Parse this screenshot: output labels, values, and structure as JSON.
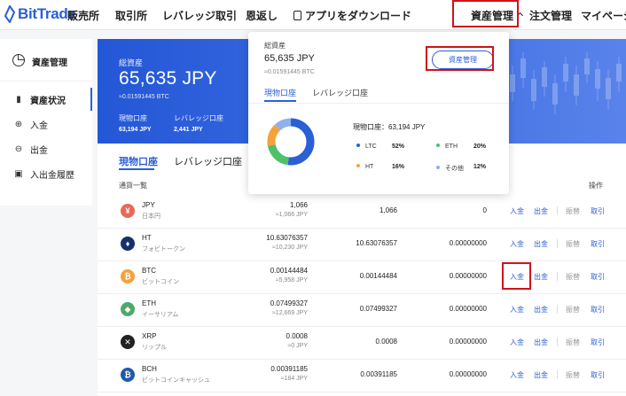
{
  "brand": {
    "name": "BitTrade",
    "color": "#2b5fd6"
  },
  "nav": {
    "exchange": "販売所",
    "trading": "取引所",
    "leverage": "レバレッジ取引",
    "rewards": "恩返し",
    "download": "アプリをダウンロード",
    "assets": "資産管理",
    "orders": "注文管理",
    "mypage": "マイページ"
  },
  "sidebar": {
    "title": "資産管理",
    "items": [
      {
        "label": "資産状況",
        "icon": "bar-chart-icon"
      },
      {
        "label": "入金",
        "icon": "deposit-icon"
      },
      {
        "label": "出金",
        "icon": "withdraw-icon"
      },
      {
        "label": "入出金履歴",
        "icon": "history-icon"
      }
    ]
  },
  "summary": {
    "label": "総資産",
    "amount": "65,635 JPY",
    "btc": "≈0.01591445 BTC",
    "spot_label": "現物口座",
    "spot_value": "63,194 JPY",
    "leverage_label": "レバレッジ口座",
    "leverage_value": "2,441 JPY"
  },
  "tabs": {
    "spot": "現物口座",
    "leverage": "レバレッジ口座"
  },
  "list": {
    "header": "通貨一覧",
    "ops_header": "操作"
  },
  "ops": {
    "deposit": "入金",
    "withdraw": "出金",
    "transfer": "振替",
    "trade": "取引"
  },
  "rows": [
    {
      "symbol": "JPY",
      "name": "日本円",
      "total": "1,066",
      "jpy": "≈1,066 JPY",
      "available": "1,066",
      "locked": "0",
      "color": "#e8685a",
      "icon": "yen-icon"
    },
    {
      "symbol": "HT",
      "name": "フォビトークン",
      "total": "10.63076357",
      "jpy": "≈10,230 JPY",
      "available": "10.63076357",
      "locked": "0.00000000",
      "color": "#17306b",
      "icon": "flame-icon"
    },
    {
      "symbol": "BTC",
      "name": "ビットコイン",
      "total": "0.00144484",
      "jpy": "≈5,958 JPY",
      "available": "0.00144484",
      "locked": "0.00000000",
      "color": "#f2a33a",
      "icon": "bitcoin-icon"
    },
    {
      "symbol": "ETH",
      "name": "イーサリアム",
      "total": "0.07499327",
      "jpy": "≈12,669 JPY",
      "available": "0.07499327",
      "locked": "0.00000000",
      "color": "#4fa86a",
      "icon": "ethereum-icon"
    },
    {
      "symbol": "XRP",
      "name": "リップル",
      "total": "0.0008",
      "jpy": "≈0 JPY",
      "available": "0.0008",
      "locked": "0.00000000",
      "color": "#222222",
      "icon": "xrp-icon"
    },
    {
      "symbol": "BCH",
      "name": "ビットコインキャッシュ",
      "total": "0.00391185",
      "jpy": "≈184 JPY",
      "available": "0.00391185",
      "locked": "0.00000000",
      "color": "#1f5aa8",
      "icon": "bitcoin-cash-icon"
    }
  ],
  "dropdown": {
    "title": "総資産",
    "amount": "65,635 JPY",
    "btc": "≈0.01591445 BTC",
    "button": "資産管理",
    "tab_spot": "現物口座",
    "tab_leverage": "レバレッジ口座",
    "spot_total": "現物口座：63,194 JPY",
    "legend": [
      {
        "name": "LTC",
        "pct": "52%",
        "color": "#2b5fd6"
      },
      {
        "name": "ETH",
        "pct": "20%",
        "color": "#4fc06a"
      },
      {
        "name": "HT",
        "pct": "16%",
        "color": "#f2a33a"
      },
      {
        "name": "その他",
        "pct": "12%",
        "color": "#8fb0ef"
      }
    ],
    "allocation": [
      52,
      20,
      16,
      12
    ]
  }
}
